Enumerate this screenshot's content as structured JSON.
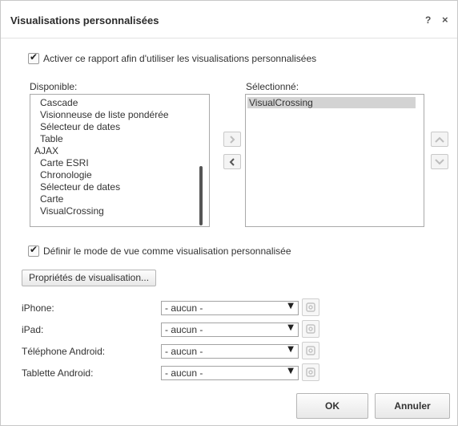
{
  "dialog": {
    "title": "Visualisations personnalisées",
    "help": "?",
    "close": "×"
  },
  "enable_checkbox": {
    "label": "Activer ce rapport afin d'utiliser les visualisations personnalisées",
    "checked": true
  },
  "available": {
    "label": "Disponible:",
    "items": [
      "Cascade",
      "Visionneuse de liste pondérée",
      "Sélecteur de dates",
      "Table",
      "AJAX",
      "Carte ESRI",
      "Chronologie",
      "Sélecteur de dates",
      "Carte",
      "VisualCrossing"
    ]
  },
  "selected": {
    "label": "Sélectionné:",
    "items": [
      "VisualCrossing"
    ]
  },
  "viewmode_checkbox": {
    "label": "Définir le mode de vue comme visualisation personnalisée",
    "checked": true
  },
  "properties_button": "Propriétés de visualisation...",
  "devices": [
    {
      "label": "iPhone:",
      "value": "- aucun -"
    },
    {
      "label": "iPad:",
      "value": "- aucun -"
    },
    {
      "label": "Téléphone Android:",
      "value": "- aucun -"
    },
    {
      "label": "Tablette Android:",
      "value": "- aucun -"
    }
  ],
  "buttons": {
    "ok": "OK",
    "cancel": "Annuler"
  }
}
